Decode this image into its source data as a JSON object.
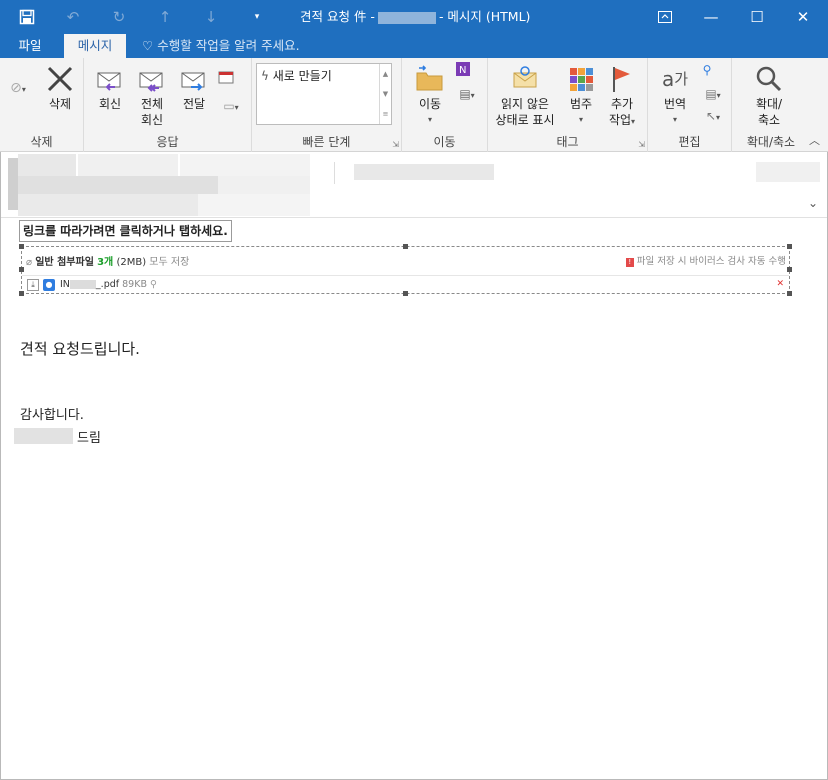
{
  "titlebar": {
    "title_prefix": "견적 요청 件 -",
    "title_suffix": "- 메시지 (HTML)",
    "minimize": "—",
    "maximize": "☐",
    "close": "✕"
  },
  "tabs": [
    {
      "label": "파일"
    },
    {
      "label": "메시지"
    }
  ],
  "tellme": {
    "placeholder": "수행할 작업을 알려 주세요."
  },
  "ribbon": {
    "delete_group": {
      "label": "삭제",
      "delete_button": "삭제"
    },
    "respond_group": {
      "label": "응답",
      "reply": "회신",
      "reply_all_line1": "전체",
      "reply_all_line2": "회신",
      "forward": "전달"
    },
    "quicksteps_group": {
      "label": "빠른 단계",
      "new": "새로 만들기"
    },
    "move_group": {
      "label": "이동",
      "move": "이동"
    },
    "tags_group": {
      "label": "태그",
      "mark_unread_line1": "읽지 않은",
      "mark_unread_line2": "상태로 표시",
      "categorize": "범주",
      "followup_line1": "추가",
      "followup_line2": "작업"
    },
    "editing_group": {
      "label": "편집",
      "translate": "번역"
    },
    "zoom_group": {
      "label": "확대/축소",
      "zoom_line1": "확대/",
      "zoom_line2": "축소"
    }
  },
  "tooltip": {
    "text": "링크를 따라가려면 클릭하거나 탭하세요."
  },
  "attachment": {
    "title": "일반 첨부파일",
    "count": "3개",
    "size": "(2MB)",
    "save_all": "모두 저장",
    "warning": "파일 저장 시 바이러스 검사 자동 수행",
    "file_prefix": "IN",
    "file_suffix": "_.pdf",
    "file_size": "89KB"
  },
  "body": {
    "line1": "견적 요청드립니다.",
    "line2": "감사합니다.",
    "signature_suffix": "드림"
  },
  "colors": {
    "titlebar": "#1f6fbf",
    "ribbon": "#f3f3f3",
    "accent_green": "#1b9e2a",
    "warning_red": "#e34a4a"
  }
}
